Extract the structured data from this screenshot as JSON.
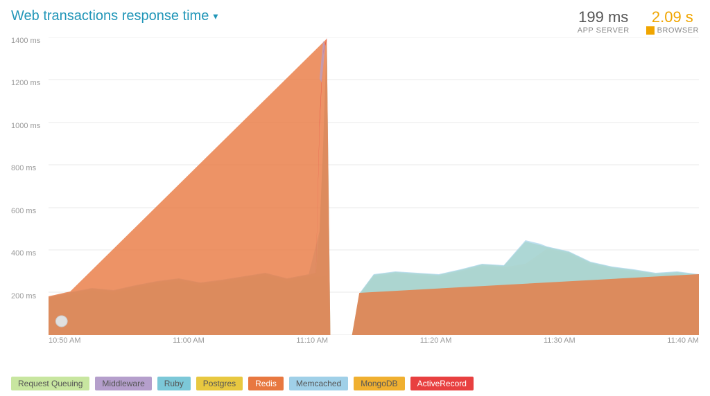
{
  "header": {
    "title": "Web transactions response time",
    "dropdown_icon": "▾",
    "stat_app_server_value": "199 ms",
    "stat_app_server_label": "APP SERVER",
    "stat_browser_value": "2.09 s",
    "stat_browser_label": "BROWSER"
  },
  "y_axis": {
    "labels": [
      "1400 ms",
      "1200 ms",
      "1000 ms",
      "800 ms",
      "600 ms",
      "400 ms",
      "200 ms",
      ""
    ]
  },
  "x_axis": {
    "labels": [
      "10:50 AM",
      "11:00 AM",
      "11:10 AM",
      "11:20 AM",
      "11:30 AM",
      "11:40 AM"
    ]
  },
  "legend": [
    {
      "id": "request-queuing",
      "label": "Request Queuing",
      "color": "#c8e6a0",
      "text_color": "#555"
    },
    {
      "id": "middleware",
      "label": "Middleware",
      "color": "#b59fcc",
      "text_color": "#555"
    },
    {
      "id": "ruby",
      "label": "Ruby",
      "color": "#7cc8d8",
      "text_color": "#555"
    },
    {
      "id": "postgres",
      "label": "Postgres",
      "color": "#e8c840",
      "text_color": "#555"
    },
    {
      "id": "redis",
      "label": "Redis",
      "color": "#e87840",
      "text_color": "#fff"
    },
    {
      "id": "memcached",
      "label": "Memcached",
      "color": "#a0c8e0",
      "text_color": "#555"
    },
    {
      "id": "mongodb",
      "label": "MongoDB",
      "color": "#f0b030",
      "text_color": "#555"
    },
    {
      "id": "activerecord",
      "label": "ActiveRecord",
      "color": "#e84040",
      "text_color": "#fff"
    }
  ],
  "colors": {
    "request_queuing": "#c8e6a0",
    "middleware": "#b59fcc",
    "ruby": "#7cc8d8",
    "postgres": "#e8c840",
    "redis": "#e87840",
    "memcached": "#a0d0e8",
    "mongodb": "#f0b030",
    "activerecord": "#e84040",
    "accent": "#2196b8"
  }
}
